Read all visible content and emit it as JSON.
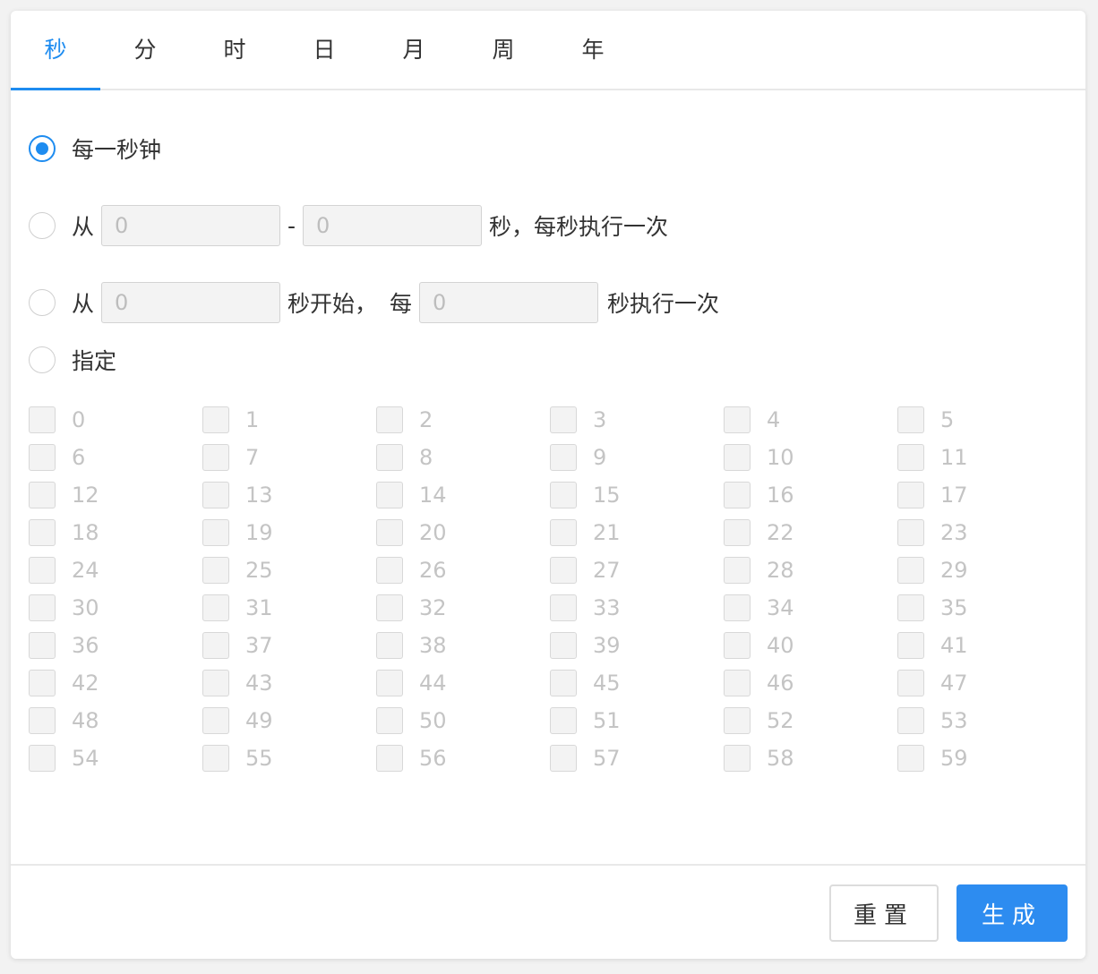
{
  "tabs": [
    "秒",
    "分",
    "时",
    "日",
    "月",
    "周",
    "年"
  ],
  "active_tab": 0,
  "accent_color": "#1e8cf0",
  "options": {
    "every": {
      "label": "每一秒钟",
      "checked": true
    },
    "range": {
      "prefix": "从",
      "from_placeholder": "0",
      "dash": "-",
      "to_placeholder": "0",
      "suffix": "秒，每秒执行一次",
      "checked": false
    },
    "step": {
      "prefix": "从",
      "start_placeholder": "0",
      "middle_text": "秒开始，",
      "every_text": "每",
      "interval_placeholder": "0",
      "suffix": "秒执行一次",
      "checked": false
    },
    "specific": {
      "label": "指定",
      "checked": false
    }
  },
  "seconds": [
    "0",
    "1",
    "2",
    "3",
    "4",
    "5",
    "6",
    "7",
    "8",
    "9",
    "10",
    "11",
    "12",
    "13",
    "14",
    "15",
    "16",
    "17",
    "18",
    "19",
    "20",
    "21",
    "22",
    "23",
    "24",
    "25",
    "26",
    "27",
    "28",
    "29",
    "30",
    "31",
    "32",
    "33",
    "34",
    "35",
    "36",
    "37",
    "38",
    "39",
    "40",
    "41",
    "42",
    "43",
    "44",
    "45",
    "46",
    "47",
    "48",
    "49",
    "50",
    "51",
    "52",
    "53",
    "54",
    "55",
    "56",
    "57",
    "58",
    "59"
  ],
  "buttons": {
    "reset": "重置",
    "generate": "生成"
  }
}
